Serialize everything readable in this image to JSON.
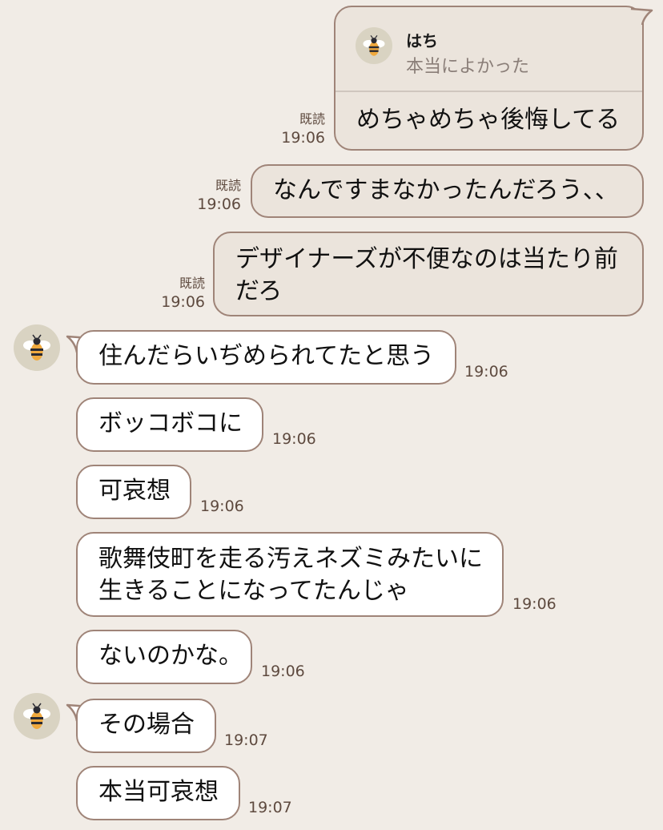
{
  "chat": {
    "reply": {
      "name": "はち",
      "quoted_text": "本当によかった"
    },
    "messages": [
      {
        "direction": "out",
        "lines": [
          "めちゃめちゃ後悔してる"
        ],
        "read": "既読",
        "time": "19:06"
      },
      {
        "direction": "out",
        "lines": [
          "なんですまなかったんだろう、、"
        ],
        "read": "既読",
        "time": "19:06"
      },
      {
        "direction": "out",
        "lines": [
          "デザイナーズが不便なのは当たり前",
          "だろ"
        ],
        "read": "既読",
        "time": "19:06"
      },
      {
        "direction": "in",
        "lines": [
          "住んだらいぢめられてたと思う"
        ],
        "time": "19:06"
      },
      {
        "direction": "in",
        "lines": [
          "ボッコボコに"
        ],
        "time": "19:06"
      },
      {
        "direction": "in",
        "lines": [
          "可哀想"
        ],
        "time": "19:06"
      },
      {
        "direction": "in",
        "lines": [
          "歌舞伎町を走る汚えネズミみたいに",
          "生きることになってたんじゃ"
        ],
        "time": "19:06"
      },
      {
        "direction": "in",
        "lines": [
          "ないのかな。"
        ],
        "time": "19:06"
      },
      {
        "direction": "in",
        "lines": [
          "その場合"
        ],
        "time": "19:07"
      },
      {
        "direction": "in",
        "lines": [
          "本当可哀想"
        ],
        "time": "19:07"
      }
    ],
    "avatar_icon": "bee-icon",
    "colors": {
      "background": "#F1ECE6",
      "outgoing_bubble": "#EBE4DC",
      "incoming_bubble": "#FFFFFF",
      "bubble_border": "#9F8478",
      "meta_text": "#5E4A3F",
      "avatar_bg": "#D9D3C2"
    }
  }
}
